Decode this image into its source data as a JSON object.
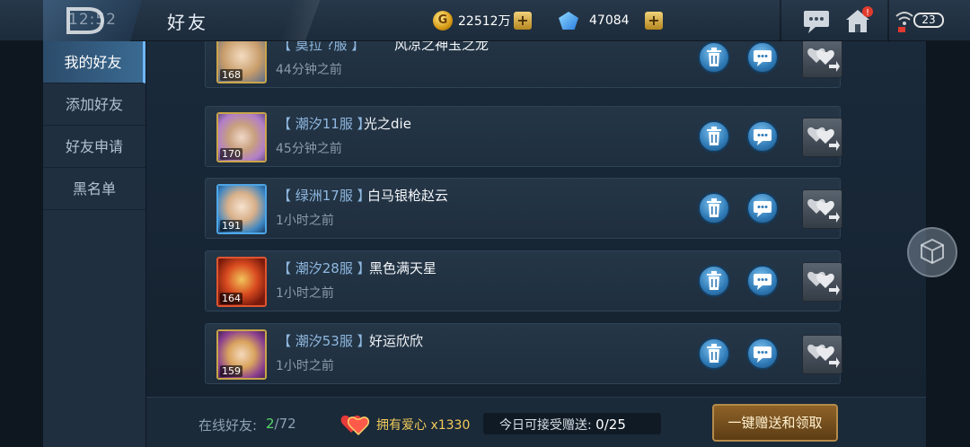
{
  "header": {
    "time": "12:52",
    "title": "好友",
    "gold": "22512万",
    "gold_symbol": "G",
    "gems": "47084",
    "plus": "+",
    "battery": "23",
    "notify_badge": "!"
  },
  "sidebar": {
    "items": [
      {
        "label": "我的好友"
      },
      {
        "label": "添加好友"
      },
      {
        "label": "好友申请"
      },
      {
        "label": "黑名单"
      }
    ]
  },
  "friends": [
    {
      "server": "【 莫拉 ?服 】",
      "name": "风凉之神玉之龙",
      "level": "168",
      "ago": "44分钟之前"
    },
    {
      "server": "【 潮汐11服 】",
      "name": "光之die",
      "level": "170",
      "ago": "45分钟之前"
    },
    {
      "server": "【 绿洲17服 】",
      "name": "白马银枪赵云",
      "level": "191",
      "ago": "1小时之前"
    },
    {
      "server": "【 潮汐28服 】",
      "name": "黑色满天星",
      "level": "164",
      "ago": "1小时之前"
    },
    {
      "server": "【 潮汐53服 】",
      "name": "好运欣欣",
      "level": "159",
      "ago": "1小时之前"
    }
  ],
  "footer": {
    "online_label": "在线好友:",
    "online_current": "2",
    "online_total": "/72",
    "love": "拥有爱心 x1330",
    "receive_label": "今日可接受赠送:",
    "receive_value": "0/25",
    "onekey_label": "一键赠送和领取"
  }
}
